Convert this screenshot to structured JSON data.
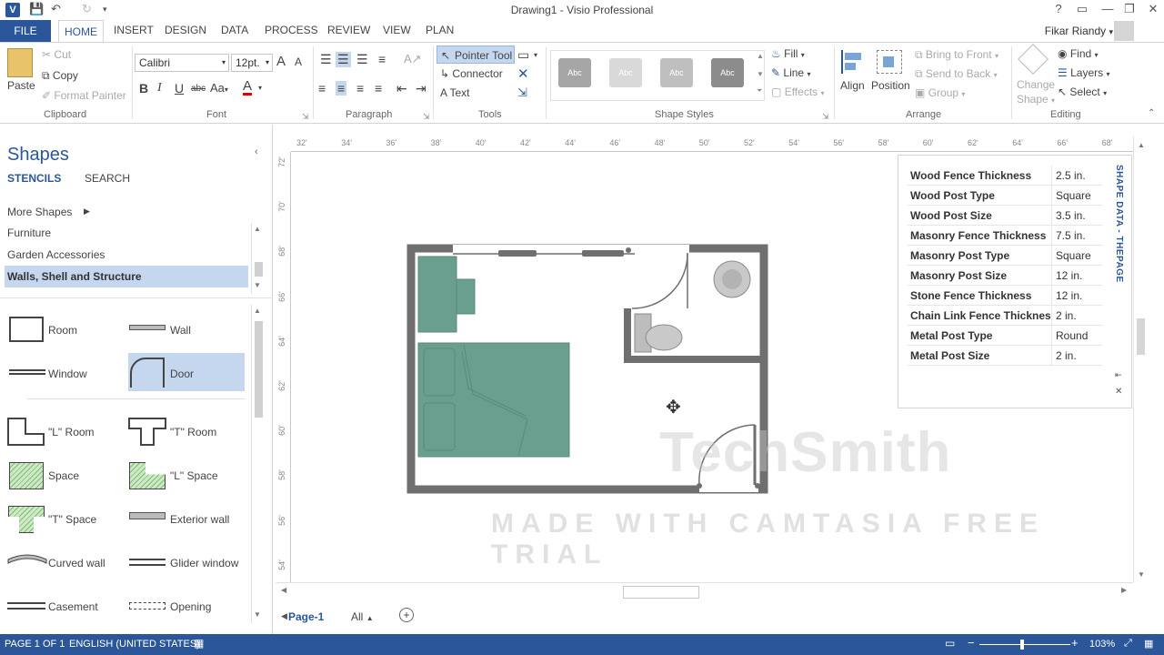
{
  "window": {
    "title": "Drawing1 - Visio Professional",
    "app_icon": "V",
    "help": "?",
    "minimize": "—",
    "restore": "❐",
    "close": "✕"
  },
  "tabs": {
    "file": "FILE",
    "home": "HOME",
    "others": [
      "INSERT",
      "DESIGN",
      "DATA",
      "PROCESS",
      "REVIEW",
      "VIEW",
      "PLAN"
    ]
  },
  "user": {
    "name": "Fikar Riandy"
  },
  "ribbon": {
    "clipboard": {
      "paste": "Paste",
      "cut": "Cut",
      "copy": "Copy",
      "format_painter": "Format Painter",
      "label": "Clipboard"
    },
    "font": {
      "family": "Calibri",
      "size": "12pt.",
      "label": "Font",
      "bold": "B",
      "italic": "I",
      "underline": "U",
      "strike": "abc",
      "case": "Aa",
      "color": "A",
      "grow": "A",
      "shrink": "A"
    },
    "paragraph": {
      "label": "Paragraph"
    },
    "tools": {
      "pointer": "Pointer Tool",
      "connector": "Connector",
      "text": "Text",
      "label": "Tools"
    },
    "shape_styles": {
      "label": "Shape Styles",
      "thumb_text": "Abc",
      "fill": "Fill",
      "line": "Line",
      "effects": "Effects"
    },
    "arrange": {
      "align": "Align",
      "position": "Position",
      "bring_to_front": "Bring to Front",
      "send_to_back": "Send to Back",
      "group": "Group",
      "label": "Arrange"
    },
    "editing": {
      "change_shape_1": "Change",
      "change_shape_2": "Shape",
      "find": "Find",
      "layers": "Layers",
      "select": "Select",
      "label": "Editing"
    }
  },
  "shapes_panel": {
    "title": "Shapes",
    "tab_stencils": "STENCILS",
    "tab_search": "SEARCH",
    "more_shapes": "More Shapes",
    "stencils": [
      "Furniture",
      "Garden Accessories",
      "Walls, Shell and Structure"
    ],
    "shapes": [
      {
        "name": "Room"
      },
      {
        "name": "Wall"
      },
      {
        "name": "Window"
      },
      {
        "name": "Door"
      },
      {
        "name": "\"L\" Room"
      },
      {
        "name": "\"T\" Room"
      },
      {
        "name": "Space"
      },
      {
        "name": "\"L\" Space"
      },
      {
        "name": "\"T\" Space"
      },
      {
        "name": "Exterior wall"
      },
      {
        "name": "Curved wall"
      },
      {
        "name": "Glider window"
      },
      {
        "name": "Casement"
      },
      {
        "name": "Opening"
      }
    ]
  },
  "ruler": {
    "top": [
      "32'",
      "34'",
      "36'",
      "38'",
      "40'",
      "42'",
      "44'",
      "46'",
      "48'",
      "50'",
      "52'",
      "54'",
      "56'",
      "58'",
      "60'",
      "62'",
      "64'",
      "66'",
      "68'"
    ],
    "left": [
      "72'",
      "70'",
      "68'",
      "66'",
      "64'",
      "62'",
      "60'",
      "58'",
      "56'",
      "54'"
    ]
  },
  "shape_data": {
    "title": "SHAPE DATA - THEPAGE",
    "rows": [
      {
        "key": "Wood Fence Thickness",
        "value": "2.5 in."
      },
      {
        "key": "Wood Post Type",
        "value": "Square"
      },
      {
        "key": "Wood Post Size",
        "value": "3.5 in."
      },
      {
        "key": "Masonry Fence Thickness",
        "value": "7.5 in."
      },
      {
        "key": "Masonry Post Type",
        "value": "Square"
      },
      {
        "key": "Masonry Post Size",
        "value": "12 in."
      },
      {
        "key": "Stone Fence Thickness",
        "value": "12 in."
      },
      {
        "key": "Chain Link Fence Thickness",
        "value": "2 in."
      },
      {
        "key": "Metal Post Type",
        "value": "Round"
      },
      {
        "key": "Metal Post Size",
        "value": "2 in."
      }
    ]
  },
  "page_tabs": {
    "page": "Page-1",
    "all": "All"
  },
  "status": {
    "page": "PAGE 1 OF 1",
    "language": "ENGLISH (UNITED STATES)",
    "zoom": "103%"
  },
  "watermark": {
    "brand": "TechSmith",
    "trial": "MADE WITH CAMTASIA FREE TRIAL"
  },
  "colors": {
    "accent": "#2b579a",
    "furniture": "#6a9e8e",
    "wall": "#6f6f6f"
  }
}
